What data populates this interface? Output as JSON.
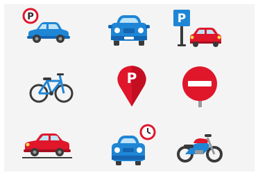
{
  "icon_grid": {
    "icons": [
      {
        "name": "car-with-parking-badge-icon"
      },
      {
        "name": "car-front-view-icon"
      },
      {
        "name": "parking-sign-with-car-icon"
      },
      {
        "name": "bicycle-icon"
      },
      {
        "name": "parking-location-pin-icon"
      },
      {
        "name": "no-entry-sign-icon"
      },
      {
        "name": "red-car-side-view-icon"
      },
      {
        "name": "car-with-clock-badge-icon"
      },
      {
        "name": "motorcycle-icon"
      }
    ],
    "parking_letter": "P",
    "colors": {
      "background": "#f4f4f4",
      "blue": "#1f86d6",
      "dark_blue": "#1565b0",
      "red": "#e0162b",
      "dark": "#3a3a3a",
      "glass": "#bfe3f7"
    }
  }
}
